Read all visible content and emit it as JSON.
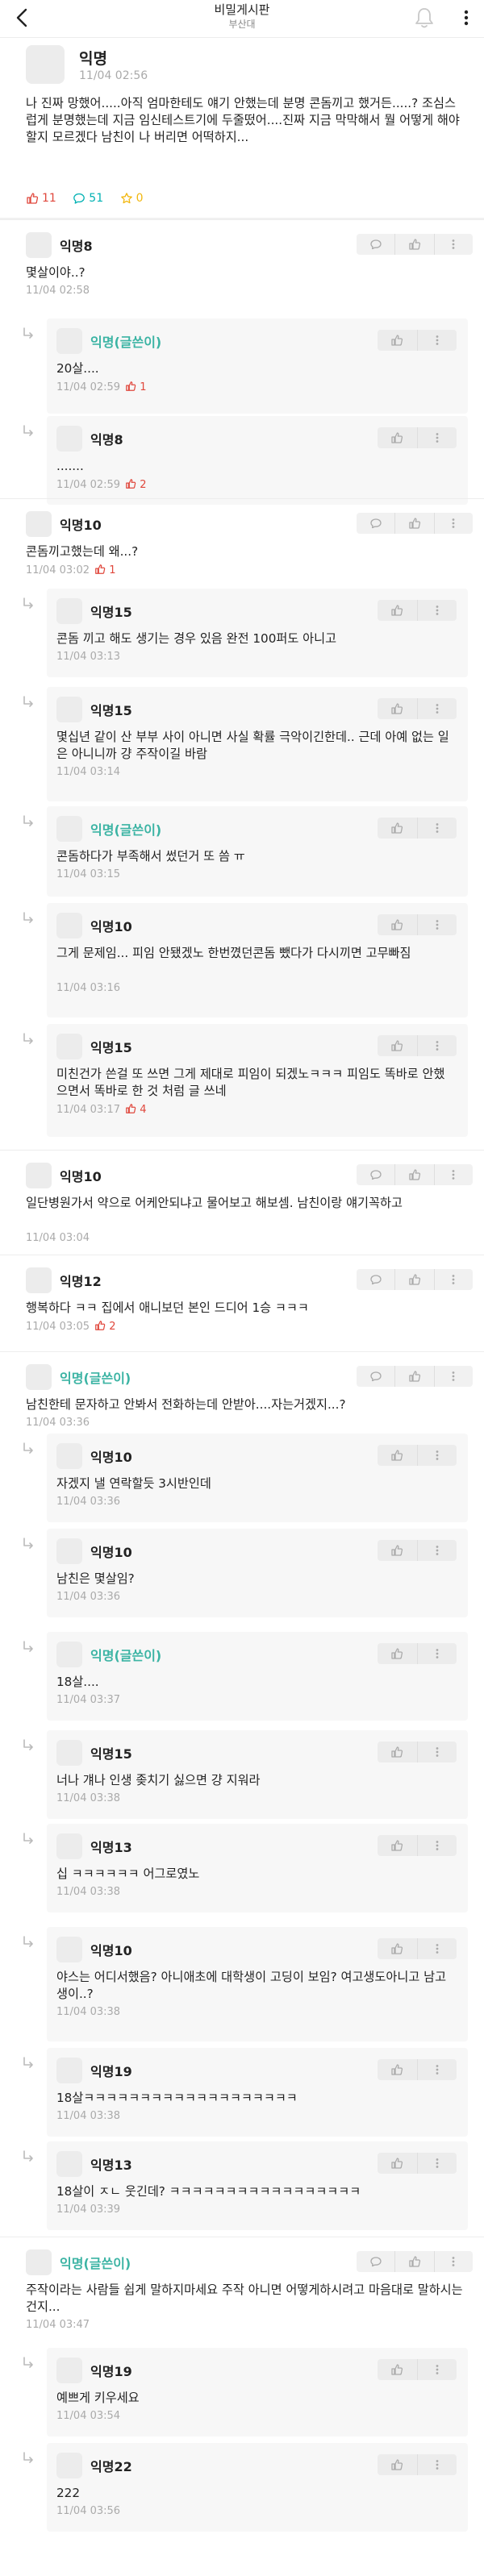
{
  "header": {
    "title": "비밀게시판",
    "subtitle": "부산대"
  },
  "post": {
    "author": "익명",
    "date": "11/04 02:56",
    "body": "나 진짜 망했어.....아직 엄마한테도 얘기 안했는데 분명 콘돔끼고 했거든.....? 조심스럽게 분명했는데 지금 임신테스트기에 두줄떴어....진짜 지금 막막해서 뭘 어떻게 해야할지 모르겠다 남친이 나 버리면 어떡하지...",
    "likes": "11",
    "comments": "51",
    "scraps": "0"
  },
  "comments": [
    {
      "author": "익명8",
      "text": "몇살이야..?",
      "date": "11/04 02:58",
      "likes": "",
      "reply": false,
      "op": false
    },
    {
      "author": "익명(글쓴이)",
      "text": "20살....",
      "date": "11/04 02:59",
      "likes": "1",
      "reply": true,
      "op": true
    },
    {
      "author": "익명8",
      "text": ".......",
      "date": "11/04 02:59",
      "likes": "2",
      "reply": true,
      "op": false
    },
    {
      "author": "익명10",
      "text": "콘돔끼고했는데 왜...?",
      "date": "11/04 03:02",
      "likes": "1",
      "reply": false,
      "op": false
    },
    {
      "author": "익명15",
      "text": "콘돔 끼고 해도 생기는 경우 있음 완전 100퍼도 아니고",
      "date": "11/04 03:13",
      "likes": "",
      "reply": true,
      "op": false
    },
    {
      "author": "익명15",
      "text": "몇십년 같이 산 부부 사이 아니면 사실 확률 극악이긴한데.. 근데 아예 없는 일은 아니니까 걍 주작이길 바람",
      "date": "11/04 03:14",
      "likes": "",
      "reply": true,
      "op": false
    },
    {
      "author": "익명(글쓴이)",
      "text": "콘돔하다가 부족해서 썼던거 또 씀 ㅠ",
      "date": "11/04 03:15",
      "likes": "",
      "reply": true,
      "op": true
    },
    {
      "author": "익명10",
      "text": "그게 문제임... 피임 안됐겠노 한번꼈던콘돔 뺐다가 다시끼면 고무빠짐",
      "date": "11/04 03:16",
      "likes": "",
      "reply": true,
      "op": false
    },
    {
      "author": "익명15",
      "text": "미친건가 쓴걸 또 쓰면 그게 제대로 피임이 되겠노ㅋㅋㅋ 피임도 똑바로 안했으면서 똑바로 한 것 처럼 글 쓰네",
      "date": "11/04 03:17",
      "likes": "4",
      "reply": true,
      "op": false
    },
    {
      "author": "익명10",
      "text": "일단병원가서 약으로 어케안되냐고 물어보고 해보셈. 남친이랑 얘기꼭하고",
      "date": "11/04 03:04",
      "likes": "",
      "reply": false,
      "op": false
    },
    {
      "author": "익명12",
      "text": "행복하다 ㅋㅋ 집에서 애니보던 본인 드디어 1승 ㅋㅋㅋ",
      "date": "11/04 03:05",
      "likes": "2",
      "reply": false,
      "op": false
    },
    {
      "author": "익명(글쓴이)",
      "text": "남친한테 문자하고 안봐서 전화하는데 안받아....자는거겠지...?",
      "date": "11/04 03:36",
      "likes": "",
      "reply": false,
      "op": true
    },
    {
      "author": "익명10",
      "text": "자겠지 낼 연락할듯 3시반인데",
      "date": "11/04 03:36",
      "likes": "",
      "reply": true,
      "op": false
    },
    {
      "author": "익명10",
      "text": "남친은 몇살임?",
      "date": "11/04 03:36",
      "likes": "",
      "reply": true,
      "op": false
    },
    {
      "author": "익명(글쓴이)",
      "text": "18살....",
      "date": "11/04 03:37",
      "likes": "",
      "reply": true,
      "op": true
    },
    {
      "author": "익명15",
      "text": "너나 걔나 인생 좆치기 싫으면 걍 지워라",
      "date": "11/04 03:38",
      "likes": "",
      "reply": true,
      "op": false
    },
    {
      "author": "익명13",
      "text": "십 ㅋㅋㅋㅋㅋㅋ 어그로였노",
      "date": "11/04 03:38",
      "likes": "",
      "reply": true,
      "op": false
    },
    {
      "author": "익명10",
      "text": "야스는 어디서했음? 아니애초에 대학생이 고딩이 보임? 여고생도아니고 남고생이..?",
      "date": "11/04 03:38",
      "likes": "",
      "reply": true,
      "op": false
    },
    {
      "author": "익명19",
      "text": "18살ㅋㅋㅋㅋㅋㅋㅋㅋㅋㅋㅋㅋㅋㅋㅋㅋㅋㅋㅋ",
      "date": "11/04 03:38",
      "likes": "",
      "reply": true,
      "op": false
    },
    {
      "author": "익명13",
      "text": "18살이 ㅈㄴ 웃긴데? ㅋㅋㅋㅋㅋㅋㅋㅋㅋㅋㅋㅋㅋㅋㅋㅋㅋ",
      "date": "11/04 03:39",
      "likes": "",
      "reply": true,
      "op": false
    },
    {
      "author": "익명(글쓴이)",
      "text": "주작이라는 사람들 쉽게 말하지마세요 주작 아니면 어떻게하시려고 마음대로 말하시는건지...",
      "date": "11/04 03:47",
      "likes": "",
      "reply": false,
      "op": true
    },
    {
      "author": "익명19",
      "text": "예쁘게 키우세요",
      "date": "11/04 03:54",
      "likes": "",
      "reply": true,
      "op": false
    },
    {
      "author": "익명22",
      "text": "222",
      "date": "11/04 03:56",
      "likes": "",
      "reply": true,
      "op": false
    }
  ]
}
